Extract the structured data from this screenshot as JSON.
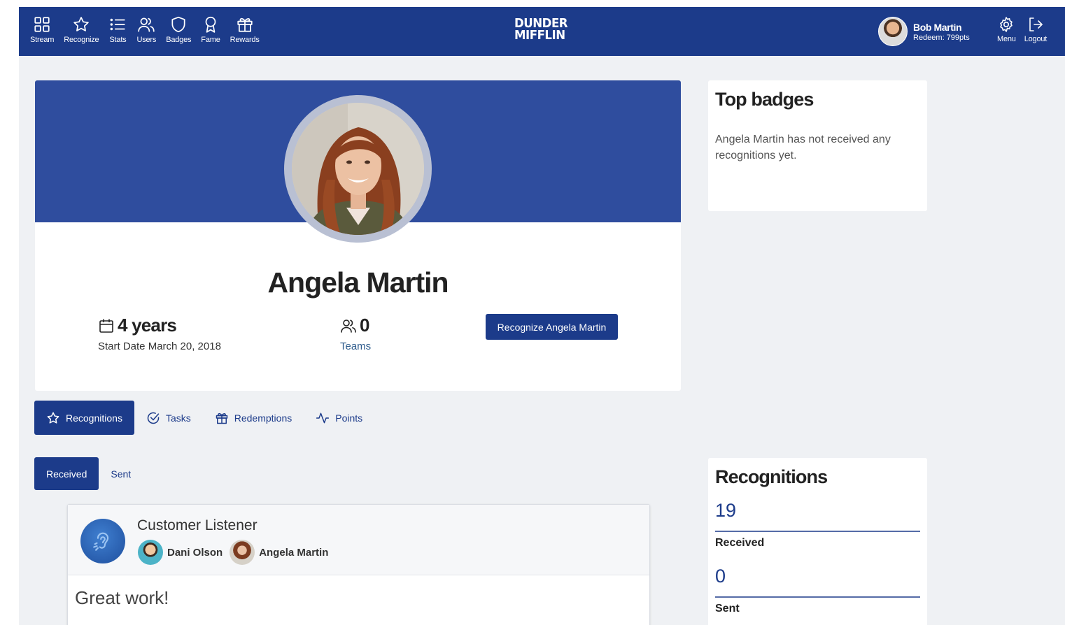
{
  "nav": {
    "items": [
      {
        "label": "Stream",
        "icon": "grid-icon"
      },
      {
        "label": "Recognize",
        "icon": "star-icon"
      },
      {
        "label": "Stats",
        "icon": "list-icon"
      },
      {
        "label": "Users",
        "icon": "users-icon"
      },
      {
        "label": "Badges",
        "icon": "shield-icon"
      },
      {
        "label": "Fame",
        "icon": "award-icon"
      },
      {
        "label": "Rewards",
        "icon": "gift-icon"
      }
    ],
    "logo_line1": "DUNDER",
    "logo_line2": "MIFFLIN",
    "user_name": "Bob Martin",
    "user_points": "Redeem: 799pts",
    "menu_label": "Menu",
    "logout_label": "Logout"
  },
  "profile": {
    "name": "Angela Martin",
    "years": "4 years",
    "start_date": "Start Date March 20, 2018",
    "teams_count": "0",
    "teams_label": "Teams",
    "recognize_button": "Recognize Angela Martin"
  },
  "tabs": [
    {
      "label": "Recognitions",
      "icon": "star-icon",
      "active": true
    },
    {
      "label": "Tasks",
      "icon": "check-circle-icon",
      "active": false
    },
    {
      "label": "Redemptions",
      "icon": "gift-icon",
      "active": false
    },
    {
      "label": "Points",
      "icon": "activity-icon",
      "active": false
    }
  ],
  "subtabs": {
    "received": "Received",
    "sent": "Sent"
  },
  "recognition": {
    "title": "Customer Listener",
    "from": "Dani Olson",
    "to": "Angela Martin",
    "message": "Great work!"
  },
  "top_badges": {
    "title": "Top badges",
    "empty_text": "Angela Martin has not received any recognitions yet."
  },
  "recognitions_summary": {
    "title": "Recognitions",
    "received_count": "19",
    "received_label": "Received",
    "sent_count": "0",
    "sent_label": "Sent"
  },
  "colors": {
    "nav_bg": "#1c3b8a",
    "banner_bg": "#2f4d9e",
    "page_bg": "#eff1f4",
    "accent": "#1c3b8a"
  }
}
